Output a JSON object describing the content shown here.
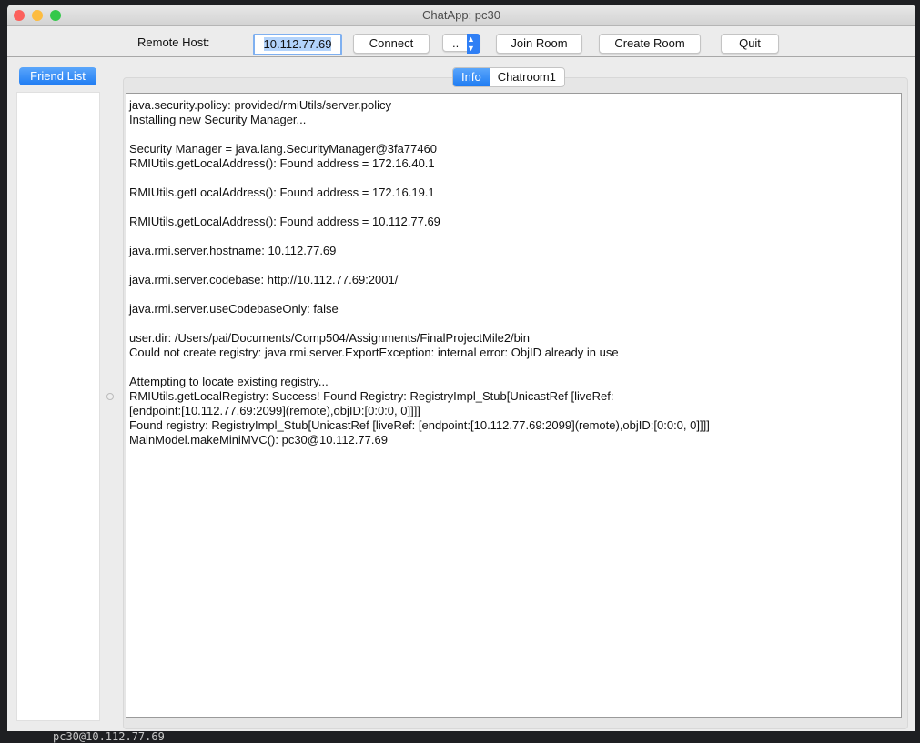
{
  "window": {
    "title": "ChatApp: pc30"
  },
  "toolbar": {
    "remote_host_label": "Remote Host:",
    "remote_host_value": "10.112.77.69",
    "connect": "Connect",
    "room_select": "..",
    "join_room": "Join Room",
    "create_room": "Create Room",
    "quit": "Quit"
  },
  "sidebar": {
    "friend_list": "Friend List"
  },
  "tabs": [
    {
      "label": "Info",
      "active": true
    },
    {
      "label": "Chatroom1",
      "active": false
    }
  ],
  "log": [
    "java.security.policy: provided/rmiUtils/server.policy",
    "Installing new Security Manager...",
    "",
    "Security Manager = java.lang.SecurityManager@3fa77460",
    "RMIUtils.getLocalAddress(): Found address = 172.16.40.1",
    "",
    "RMIUtils.getLocalAddress(): Found address = 172.16.19.1",
    "",
    "RMIUtils.getLocalAddress(): Found address = 10.112.77.69",
    "",
    "java.rmi.server.hostname: 10.112.77.69",
    "",
    "java.rmi.server.codebase: http://10.112.77.69:2001/",
    "",
    "java.rmi.server.useCodebaseOnly: false",
    "",
    "user.dir: /Users/pai/Documents/Comp504/Assignments/FinalProjectMile2/bin",
    "Could not create registry: java.rmi.server.ExportException: internal error: ObjID already in use",
    "",
    "Attempting to locate existing registry...",
    "RMIUtils.getLocalRegistry: Success! Found Registry: RegistryImpl_Stub[UnicastRef [liveRef:",
    "[endpoint:[10.112.77.69:2099](remote),objID:[0:0:0, 0]]]]",
    "Found registry: RegistryImpl_Stub[UnicastRef [liveRef: [endpoint:[10.112.77.69:2099](remote),objID:[0:0:0, 0]]]]",
    "MainModel.makeMiniMVC(): pc30@10.112.77.69"
  ],
  "background": {
    "terminal_text": "pc30@10.112.77.69"
  }
}
